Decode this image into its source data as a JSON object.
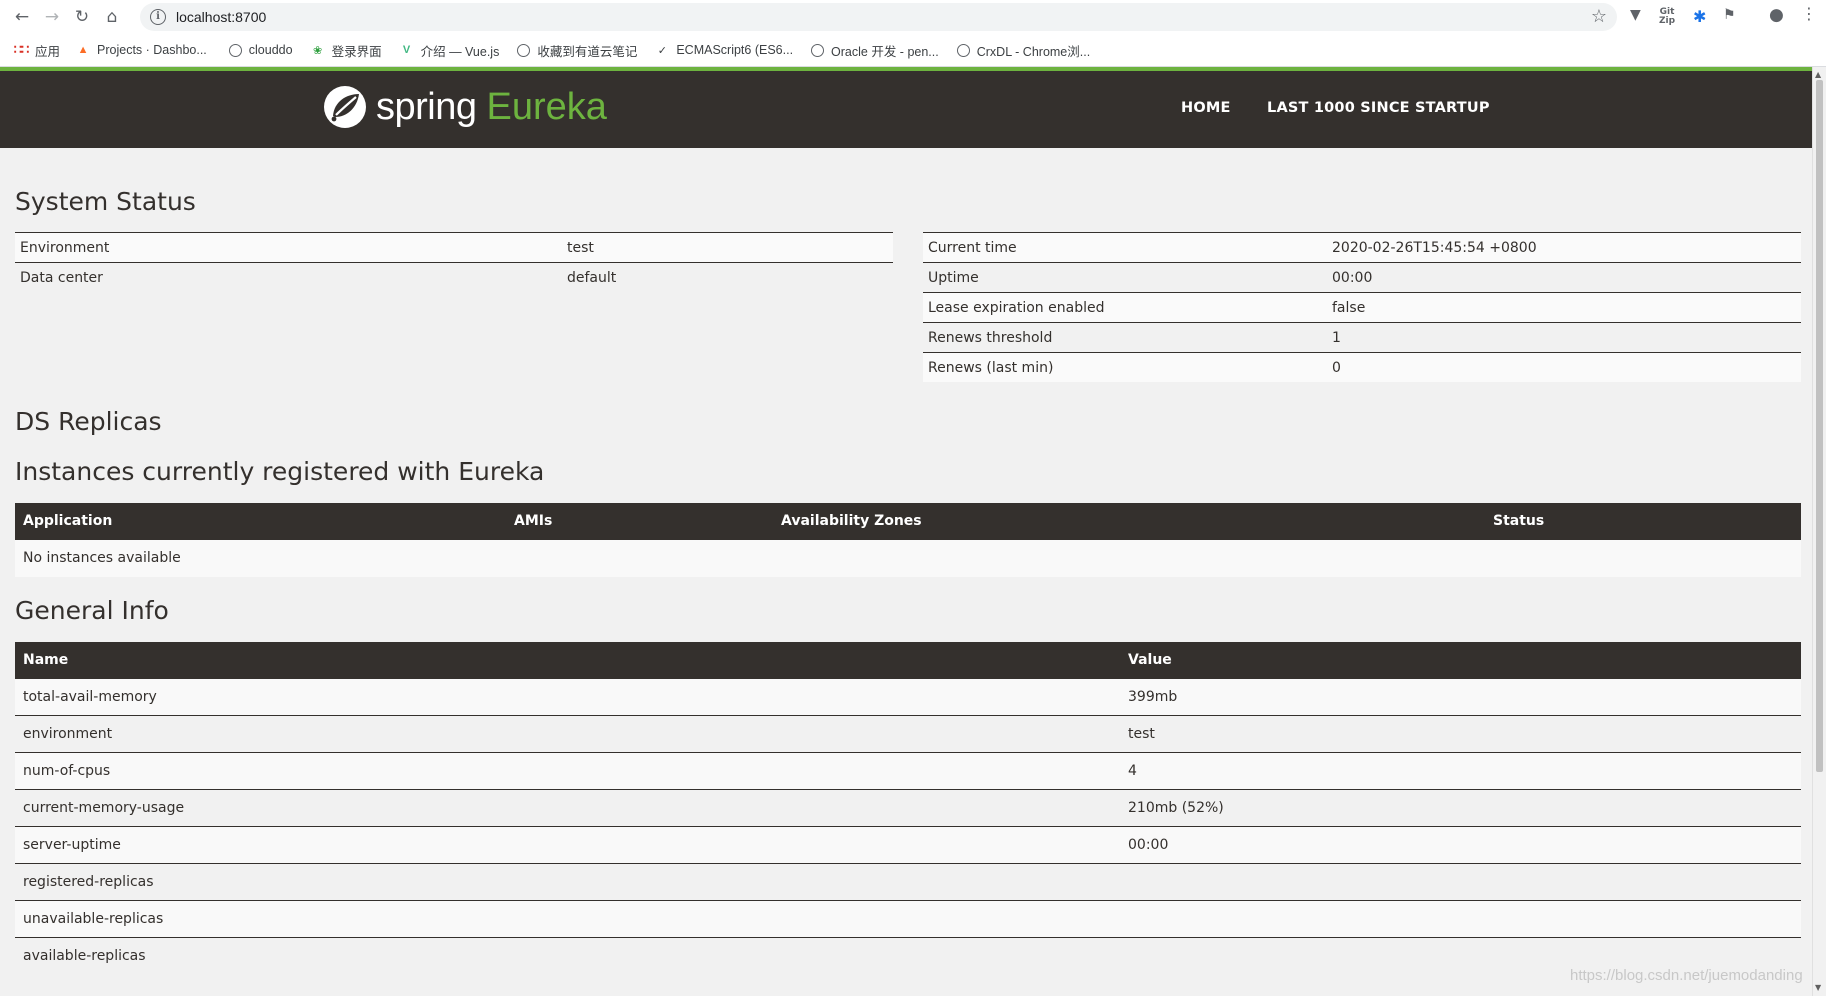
{
  "browser": {
    "url": "localhost:8700",
    "bookmarks": [
      {
        "label": "应用",
        "icon": "apps-grid-icon"
      },
      {
        "label": "Projects · Dashbo...",
        "icon": "gitlab-icon"
      },
      {
        "label": "clouddo",
        "icon": "globe-icon"
      },
      {
        "label": "登录界面",
        "icon": "green-leaf-icon"
      },
      {
        "label": "介绍 — Vue.js",
        "icon": "vue-icon"
      },
      {
        "label": "收藏到有道云笔记",
        "icon": "globe-icon"
      },
      {
        "label": "ECMAScript6 (ES6...",
        "icon": "compass-icon"
      },
      {
        "label": "Oracle 开发 - pen...",
        "icon": "globe-icon"
      },
      {
        "label": "CrxDL - Chrome浏...",
        "icon": "globe-icon"
      }
    ]
  },
  "header": {
    "logo_spring": "spring",
    "logo_eureka": "Eureka",
    "nav": [
      "HOME",
      "LAST 1000 SINCE STARTUP"
    ]
  },
  "system_status": {
    "title": "System Status",
    "left": [
      {
        "name": "Environment",
        "value": "test"
      },
      {
        "name": "Data center",
        "value": "default"
      }
    ],
    "right": [
      {
        "name": "Current time",
        "value": "2020-02-26T15:45:54 +0800"
      },
      {
        "name": "Uptime",
        "value": "00:00"
      },
      {
        "name": "Lease expiration enabled",
        "value": "false"
      },
      {
        "name": "Renews threshold",
        "value": "1"
      },
      {
        "name": "Renews (last min)",
        "value": "0"
      }
    ]
  },
  "ds_replicas": {
    "title": "DS Replicas"
  },
  "instances": {
    "title": "Instances currently registered with Eureka",
    "columns": [
      "Application",
      "AMIs",
      "Availability Zones",
      "Status"
    ],
    "empty_text": "No instances available"
  },
  "general_info": {
    "title": "General Info",
    "columns": [
      "Name",
      "Value"
    ],
    "rows": [
      {
        "name": "total-avail-memory",
        "value": "399mb"
      },
      {
        "name": "environment",
        "value": "test"
      },
      {
        "name": "num-of-cpus",
        "value": "4"
      },
      {
        "name": "current-memory-usage",
        "value": "210mb (52%)"
      },
      {
        "name": "server-uptime",
        "value": "00:00"
      },
      {
        "name": "registered-replicas",
        "value": ""
      },
      {
        "name": "unavailable-replicas",
        "value": ""
      },
      {
        "name": "available-replicas",
        "value": ""
      }
    ]
  },
  "watermark": "https://blog.csdn.net/juemodanding",
  "colors": {
    "brand_green": "#6db33f",
    "header_dark": "#34302d"
  }
}
